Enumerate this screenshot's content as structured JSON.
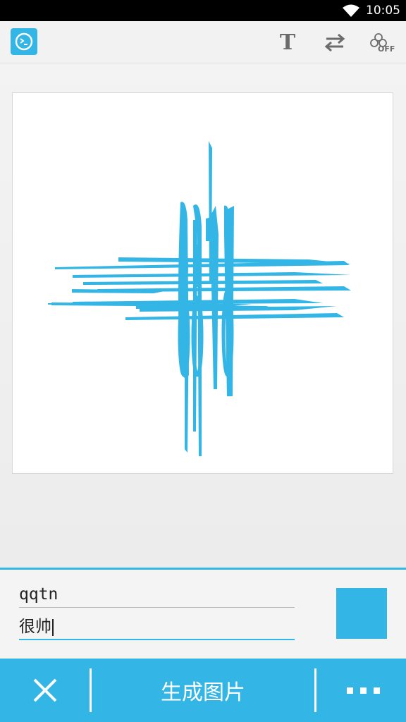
{
  "status_bar": {
    "time": "10:05",
    "wifi_icon": "wifi-icon"
  },
  "app_bar": {
    "app_icon": "terminal-app-icon",
    "text_action": "T",
    "swap_icon": "swap-arrows-icon",
    "off_label": "OFF"
  },
  "preview": {
    "text": "qqtn",
    "color": "#33b5e5"
  },
  "inputs": {
    "line1": "qqtn",
    "line2": "很帅",
    "swatch_color": "#33b5e5"
  },
  "bottom_bar": {
    "close_icon": "close-icon",
    "generate_label": "生成图片",
    "more_icon": "more-icon"
  }
}
